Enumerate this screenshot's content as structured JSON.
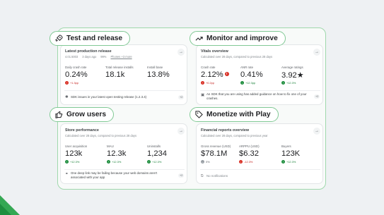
{
  "colors": {
    "accent_green": "#34a853",
    "positive": "#188038",
    "negative": "#c5221f",
    "neutral": "#5f6368"
  },
  "sections": {
    "test": {
      "title": "Test and release",
      "icon": "rocket-icon",
      "card_title": "Latest production release",
      "meta": [
        "4.01.5003",
        "3 days ago",
        "99%",
        "Phones +3 more"
      ],
      "metrics": [
        {
          "label": "Daily crash rate",
          "value": "0.24%",
          "delta": "+1.3pp",
          "trend": "down"
        },
        {
          "label": "Total release installs",
          "value": "18.1k"
        },
        {
          "label": "Install base",
          "value": "13.8%"
        }
      ],
      "note": "SDK issues in your latest open testing release (1.2.3.4)",
      "note_badge": "+2"
    },
    "monitor": {
      "title": "Monitor and improve",
      "icon": "trend-icon",
      "card_title": "Vitals overview",
      "card_sub": "Calculated over 28 days, compared to previous 28 days",
      "metrics": [
        {
          "label": "Crash rate",
          "value": "2.12%",
          "delta": "+0.2pp",
          "trend": "down",
          "alert": "!"
        },
        {
          "label": "ANR rate",
          "value": "0.41%",
          "delta": "+12.3pp",
          "trend": "up"
        },
        {
          "label": "Average ratings",
          "value": "3.92★",
          "delta": "+12.3%",
          "trend": "up"
        }
      ],
      "note": "An SDK that you are using has added guidance on how to fix one of your crashes.",
      "note_badge": "+2"
    },
    "grow": {
      "title": "Grow users",
      "icon": "thumbs-up-icon",
      "card_title": "Store performance",
      "card_sub": "Calculated over 28 days, compared to previous 28 days",
      "metrics": [
        {
          "label": "User acquisition",
          "value": "123k",
          "delta": "+12.3%",
          "trend": "up"
        },
        {
          "label": "MAU",
          "value": "12.3k",
          "delta": "+12.3%",
          "trend": "up"
        },
        {
          "label": "Uninstalls",
          "value": "1,234",
          "delta": "+12.3%",
          "trend": "up"
        }
      ],
      "note": "One deep link may be failing because your web domains aren't associated with your app",
      "note_badge": "+2"
    },
    "monetize": {
      "title": "Monetize with Play",
      "icon": "tag-icon",
      "card_title": "Financial reports overview",
      "card_sub": "Calculated over 28 days, compared to previous year",
      "metrics": [
        {
          "label": "Gross revenue (USD)",
          "value": "$78.1M",
          "delta": "0%",
          "trend": "flat"
        },
        {
          "label": "ARPPU (USD)",
          "value": "$6.32",
          "delta": "-12.3%",
          "trend": "down"
        },
        {
          "label": "Buyers",
          "value": "123K",
          "delta": "+12.3%",
          "trend": "up"
        }
      ],
      "note": "No notifications"
    }
  }
}
